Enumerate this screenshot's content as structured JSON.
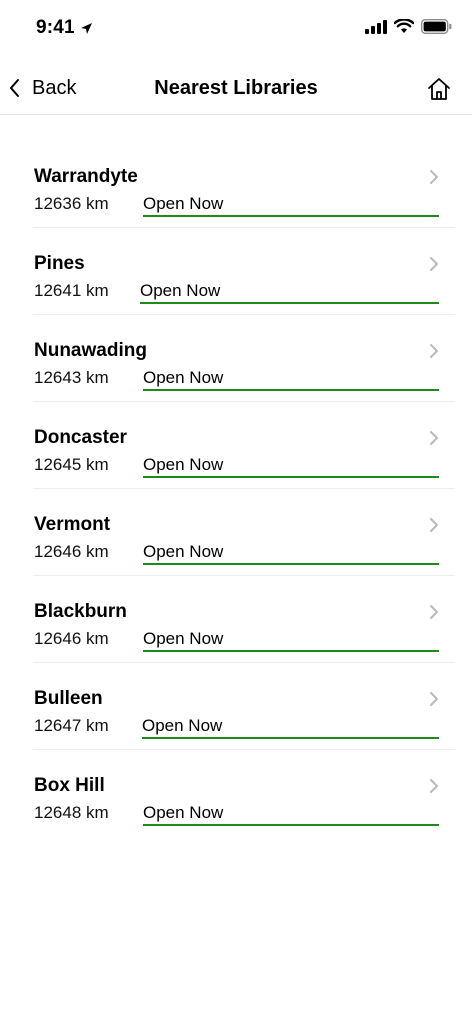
{
  "status_bar": {
    "time": "9:41"
  },
  "nav": {
    "back_label": "Back",
    "title": "Nearest Libraries"
  },
  "libraries": [
    {
      "name": "Warrandyte",
      "distance": "12636 km",
      "status": "Open Now"
    },
    {
      "name": "Pines",
      "distance": "12641 km",
      "status": "Open Now"
    },
    {
      "name": "Nunawading",
      "distance": "12643 km",
      "status": "Open Now"
    },
    {
      "name": "Doncaster",
      "distance": "12645 km",
      "status": "Open Now"
    },
    {
      "name": "Vermont",
      "distance": "12646 km",
      "status": "Open Now"
    },
    {
      "name": "Blackburn",
      "distance": "12646 km",
      "status": "Open Now"
    },
    {
      "name": "Bulleen",
      "distance": "12647 km",
      "status": "Open Now"
    },
    {
      "name": "Box Hill",
      "distance": "12648 km",
      "status": "Open Now"
    }
  ],
  "colors": {
    "open_underline": "#1e8a1e",
    "chevron": "#b8b8bd"
  }
}
